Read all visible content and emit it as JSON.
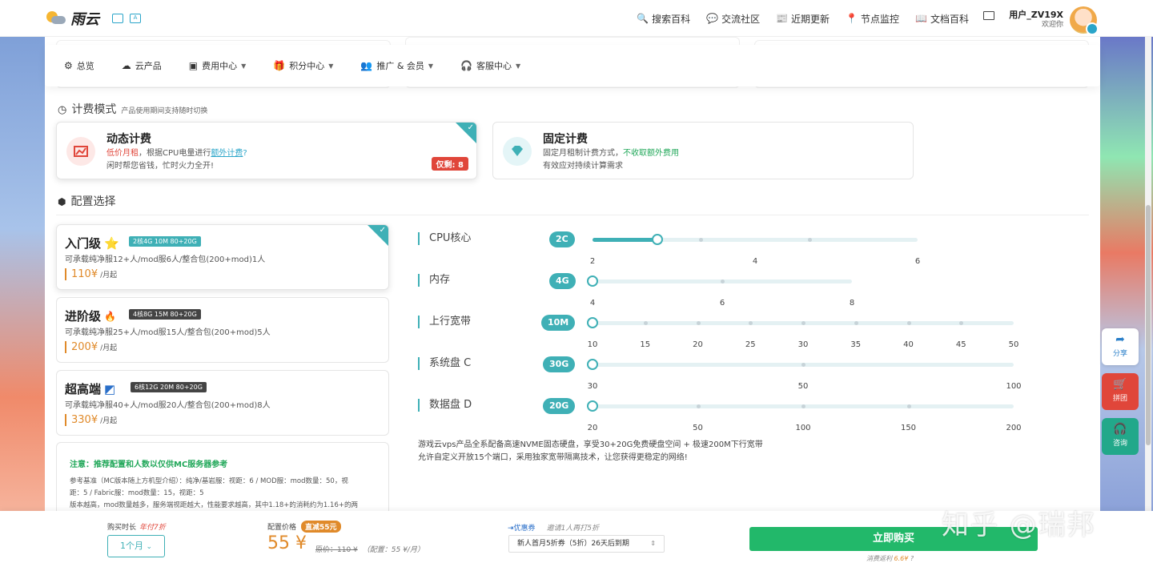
{
  "brand": {
    "name": "雨云"
  },
  "topnav": [
    {
      "icon": "🔍",
      "label": "搜索百科"
    },
    {
      "icon": "💬",
      "label": "交流社区"
    },
    {
      "icon": "📰",
      "label": "近期更新"
    },
    {
      "icon": "📍",
      "label": "节点监控"
    },
    {
      "icon": "📖",
      "label": "文档百科"
    }
  ],
  "user": {
    "name": "用户_ZV19X",
    "welcome": "欢迎你"
  },
  "submenu": [
    {
      "icon": "⚙",
      "label": "总览",
      "dropdown": false
    },
    {
      "icon": "☁",
      "label": "云产品",
      "dropdown": false
    },
    {
      "icon": "▣",
      "label": "费用中心",
      "dropdown": true
    },
    {
      "icon": "🎁",
      "label": "积分中心",
      "dropdown": true
    },
    {
      "icon": "👥",
      "label": "推广 & 会员",
      "dropdown": true
    },
    {
      "icon": "🎧",
      "label": "客服中心",
      "dropdown": true
    }
  ],
  "billing": {
    "title": "计费模式",
    "subtitle": "产品使用期间支持随时切换",
    "dynamic": {
      "title": "动态计费",
      "line1_red": "低价月租",
      "line1_mid": "，根据CPU电量进行",
      "line1_link": "额外计费",
      "line2": "闲时帮您省钱，忙时火力全开!",
      "remain": "仅剩: 8",
      "selected": true
    },
    "fixed": {
      "title": "固定计费",
      "line1": "固定月租制计费方式，",
      "line1_green": "不收取额外费用",
      "line2": "有效应对持续计算需求",
      "selected": false
    }
  },
  "config": {
    "title": "配置选择",
    "tiers": [
      {
        "name": "入门级",
        "icon": "⭐",
        "tag": "2核4G 10M 80+20G",
        "desc": "可承载纯净服12+人/mod服6人/整合包(200+mod)1人",
        "price": "110¥",
        "unit": "/月起",
        "selected": true
      },
      {
        "name": "进阶级",
        "icon": "🔥",
        "tag": "4核8G 15M 80+20G",
        "desc": "可承载纯净服25+人/mod服15人/整合包(200+mod)5人",
        "price": "200¥",
        "unit": "/月起",
        "selected": false
      },
      {
        "name": "超高端",
        "icon": "◩",
        "tag": "6核12G 20M 80+20G",
        "desc": "可承载纯净服40+人/mod服20人/整合包(200+mod)8人",
        "price": "330¥",
        "unit": "/月起",
        "selected": false
      }
    ],
    "note": {
      "title": "注意：推荐配置和人数以仅供MC服务器参考",
      "lines": [
        "参考基准（MC版本随上方机型介绍）：纯净/基岩服：视距：6 / MOD服：mod数量：50，视",
        "距：5 / Fabric服：mod数量：15，视距：5",
        "版本越高，mod数量越多，服务端视距越大，性能要求越高，其中1.18+的消耗约为1.16+的两"
      ]
    }
  },
  "sliders": [
    {
      "label": "CPU核心",
      "value": "2C",
      "ticks": [
        "2",
        "4",
        "6"
      ],
      "level": 0.2
    },
    {
      "label": "内存",
      "value": "4G",
      "ticks": [
        "4",
        "6",
        "8"
      ],
      "level": 0
    },
    {
      "label": "上行宽带",
      "value": "10M",
      "ticks": [
        "10",
        "15",
        "20",
        "25",
        "30",
        "35",
        "40",
        "45",
        "50"
      ],
      "level": 0
    },
    {
      "label": "系统盘 C",
      "value": "30G",
      "ticks": [
        "30",
        "50",
        "100"
      ],
      "level": 0
    },
    {
      "label": "数据盘 D",
      "value": "20G",
      "ticks": [
        "20",
        "50",
        "100",
        "150",
        "200"
      ],
      "level": 0
    }
  ],
  "description": {
    "line1": "游戏云vps产品全系配备高速NVME固态硬盘，享受30+20G免费硬盘空间 + 极速200M下行宽带",
    "line2": "允许自定义开放15个端口，采用独家宽带隔离技术，让您获得更稳定的网络!"
  },
  "bottom": {
    "duration_label": "购买时长",
    "duration_discount": "年付7折",
    "duration_value": "1个月",
    "price_label": "配置价格",
    "price_tag": "直减55元",
    "price": "55 ¥",
    "original": "原价：110 ¥",
    "config_price": "（配置：55 ¥/月）",
    "coupon_label": "优惠券",
    "coupon_hint": "邀请1人再打5折",
    "coupon_value": "新人首月5折券（5折）26天后到期",
    "buy_label": "立即购买",
    "rebate_label": "消费返利",
    "rebate_value": "6.6¥"
  },
  "float": [
    {
      "icon": "➦",
      "label": "分享"
    },
    {
      "icon": "🛒",
      "label": "拼团"
    },
    {
      "icon": "🎧",
      "label": "咨询"
    }
  ],
  "watermark": "知乎 @瑞邦",
  "colors": {
    "accent": "#3fb0b6",
    "buy": "#22b86a",
    "price": "#e08a2a",
    "danger": "#e0463a"
  }
}
